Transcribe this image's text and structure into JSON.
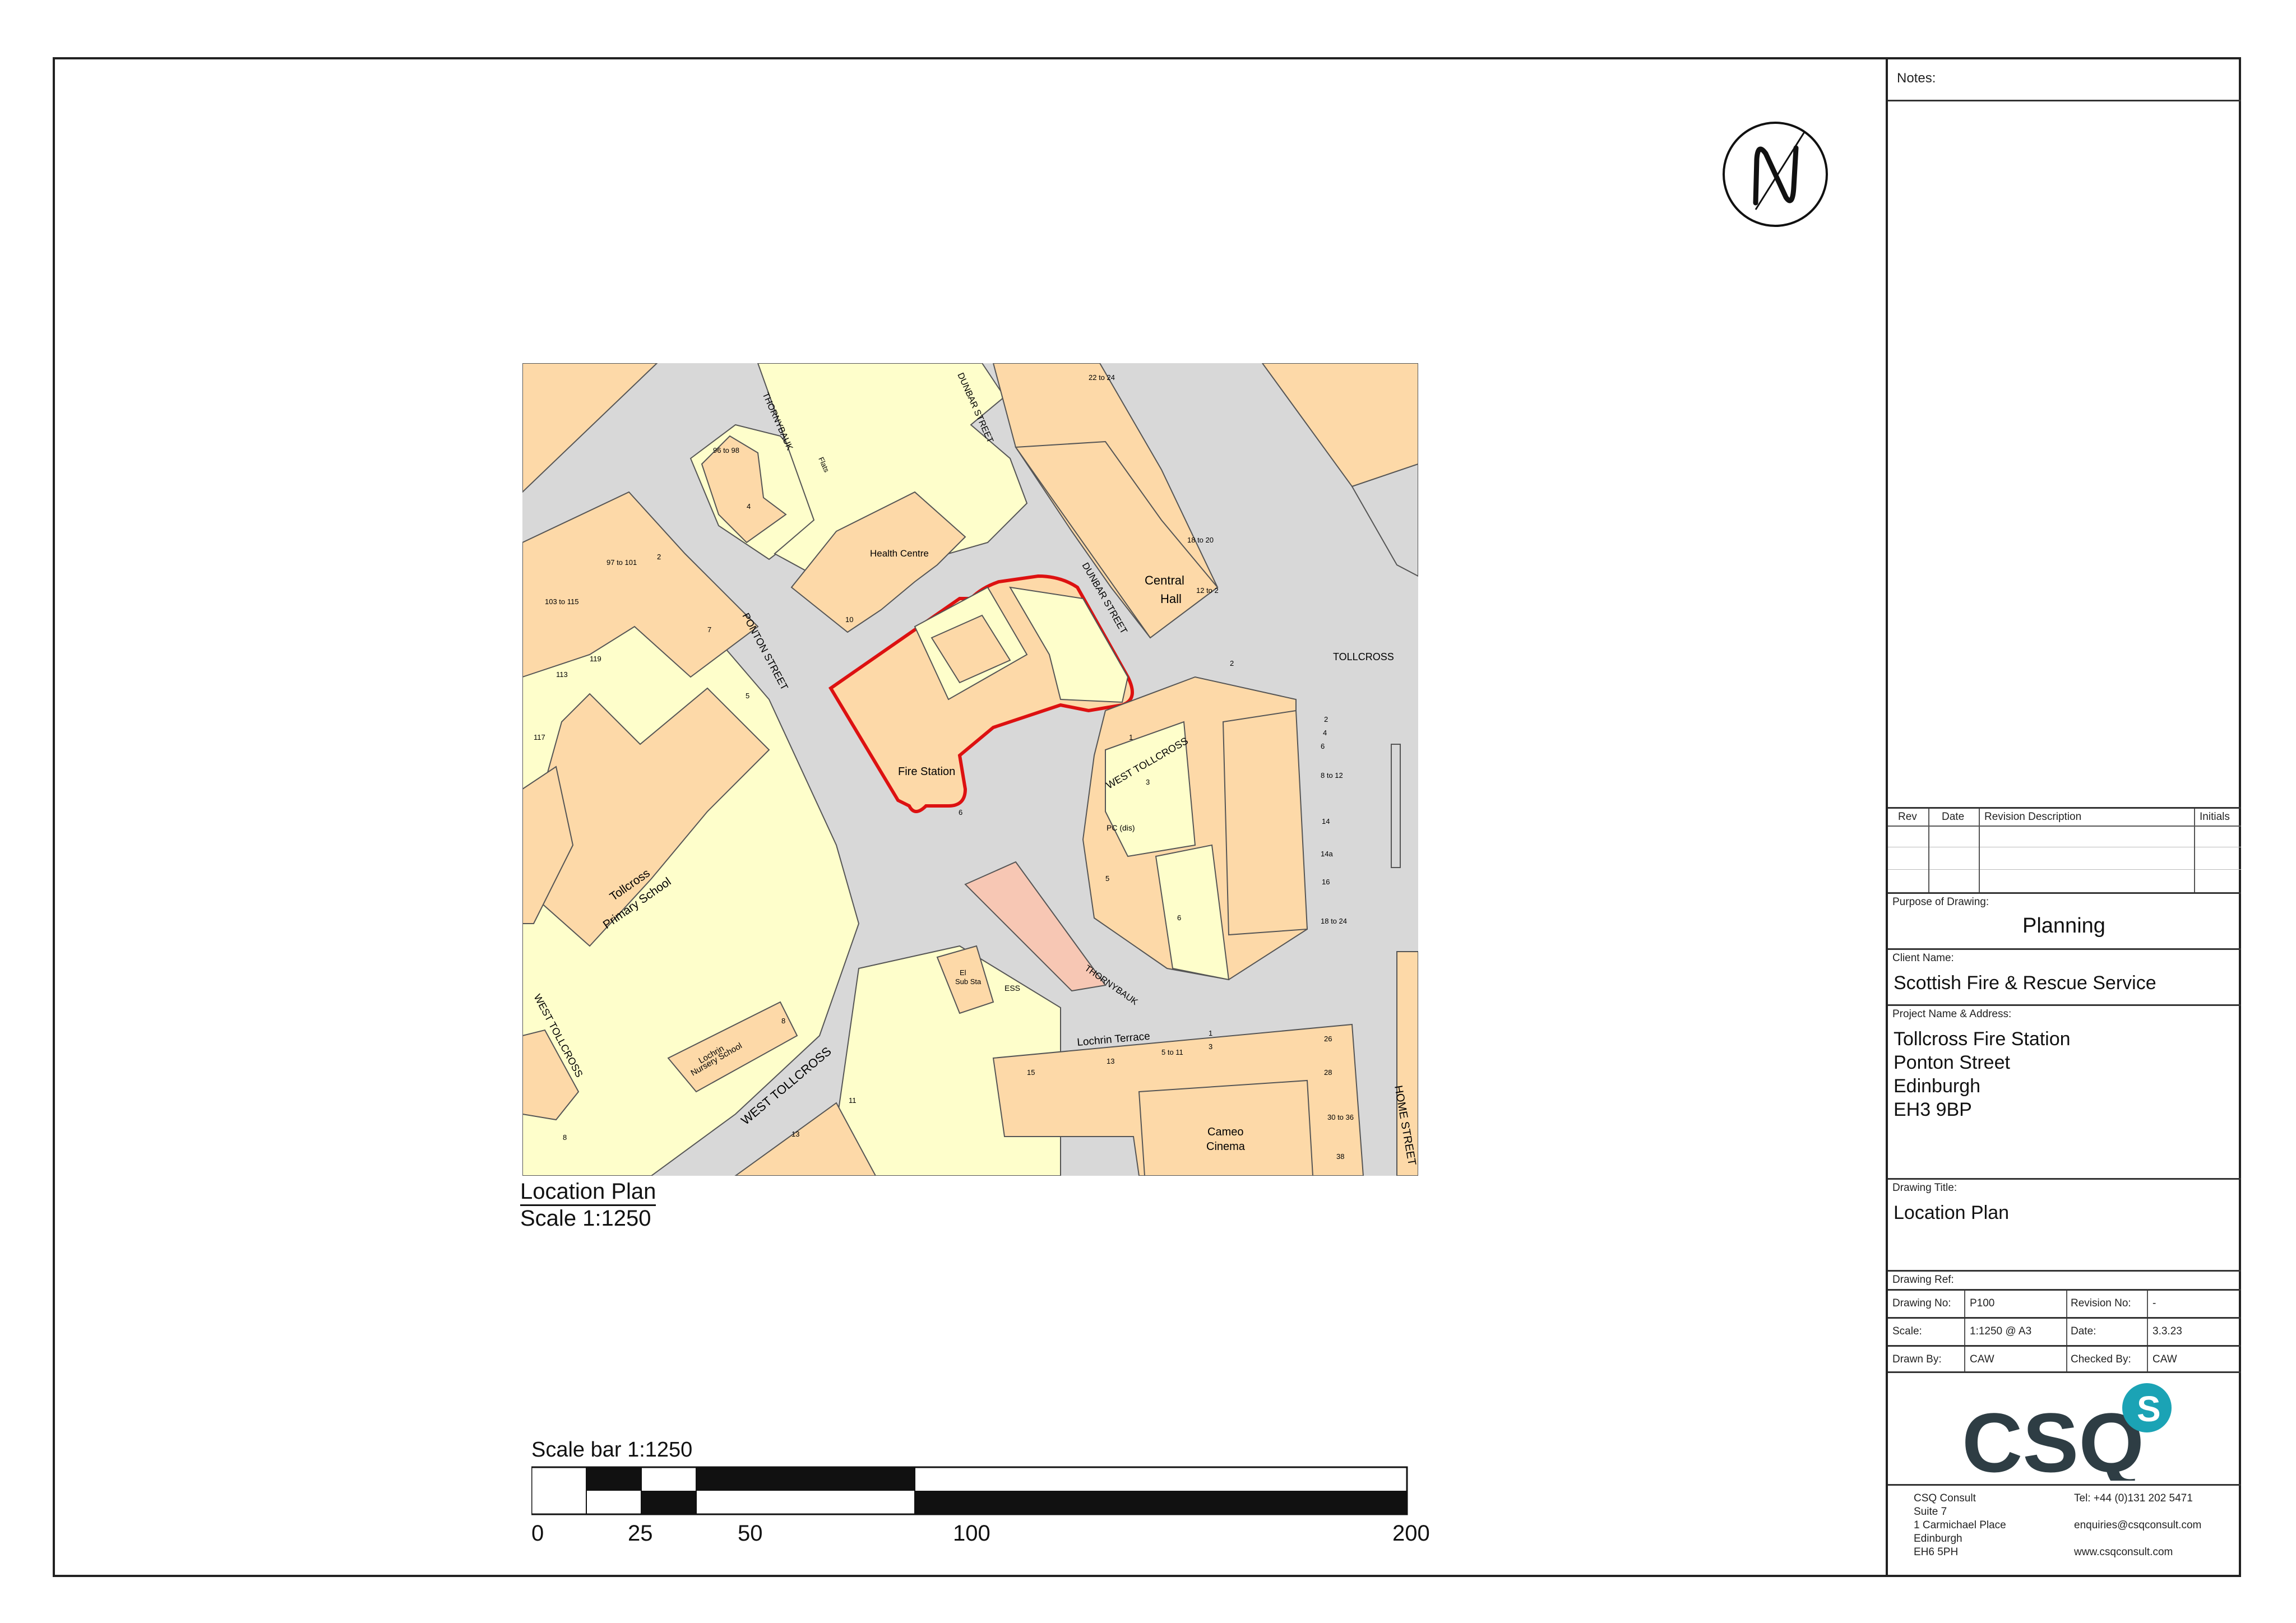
{
  "notes_label": "Notes:",
  "revision_table": {
    "headers": [
      "Rev",
      "Date",
      "Revision Description",
      "Initials"
    ]
  },
  "purpose": {
    "label": "Purpose of Drawing:",
    "value": "Planning"
  },
  "client": {
    "label": "Client Name:",
    "value": "Scottish Fire & Rescue Service"
  },
  "project": {
    "label": "Project Name & Address:",
    "lines": [
      "Tollcross Fire Station",
      "Ponton Street",
      "Edinburgh",
      "EH3 9BP"
    ]
  },
  "drawing_title": {
    "label": "Drawing Title:",
    "value": "Location Plan"
  },
  "drawing_ref": {
    "label": "Drawing Ref:",
    "drawing_no_label": "Drawing No:",
    "drawing_no": "P100",
    "revision_no_label": "Revision No:",
    "revision_no": "-",
    "scale_label": "Scale:",
    "scale": "1:1250 @ A3",
    "date_label": "Date:",
    "date": "3.3.23",
    "drawn_by_label": "Drawn By:",
    "drawn_by": "CAW",
    "checked_by_label": "Checked By:",
    "checked_by": "CAW"
  },
  "company": {
    "logo_text": "CSQ",
    "logo_badge": "S",
    "address": [
      "CSQ Consult",
      "Suite 7",
      "1 Carmichael Place",
      "Edinburgh",
      "EH6 5PH"
    ],
    "tel": "Tel: +44 (0)131 202 5471",
    "email": "enquiries@csqconsult.com",
    "web": "www.csqconsult.com"
  },
  "plan_caption": {
    "title": "Location Plan",
    "scale": "Scale 1:1250"
  },
  "scale_bar": {
    "title": "Scale bar 1:1250",
    "ticks": [
      "0",
      "25",
      "50",
      "100",
      "200"
    ]
  },
  "map_labels": {
    "fire_station": "Fire Station",
    "health_centre": "Health Centre",
    "central_hall": [
      "Central",
      "Hall"
    ],
    "tollcross": "TOLLCROSS",
    "west_tollcross": "WEST   TOLLCROSS",
    "west_tollcross_lower": "WEST   TOLLCROSS",
    "west_tollcross_left": "WEST TOLLCROSS",
    "ponton_street": "PONTON STREET",
    "dunbar_street": "DUNBAR STREET",
    "dunbar_street_top": "DUNBAR STREET",
    "thornybauk_top": "THORNYBAUK",
    "thornybauk_lower": "THORNYBAUK",
    "lochrin_terrace": "Lochrin Terrace",
    "home_street": "HOME STREET",
    "primary_school": [
      "Tollcross",
      "Primary School"
    ],
    "nursery_school": [
      "Lochrin",
      "Nursery School"
    ],
    "cameo_cinema": [
      "Cameo",
      "Cinema"
    ],
    "pc": "PC (dis)",
    "ess": "ESS",
    "el_sub_sta": [
      "El",
      "Sub Sta"
    ],
    "flats": "Flats",
    "numbers": [
      "10",
      "6",
      "5",
      "7",
      "2",
      "119",
      "117",
      "113",
      "103 to 115",
      "97 to 101",
      "96 to 98",
      "4",
      "18 to 20",
      "12 to 2",
      "2",
      "2",
      "4",
      "6",
      "8 to 12",
      "14",
      "14a",
      "16",
      "18 to 24",
      "26",
      "28",
      "30 to 36",
      "38",
      "15",
      "13",
      "5 to 11",
      "3",
      "1",
      "11",
      "13",
      "8",
      "1",
      "3",
      "5",
      "6",
      "22 to 24",
      "8"
    ]
  }
}
